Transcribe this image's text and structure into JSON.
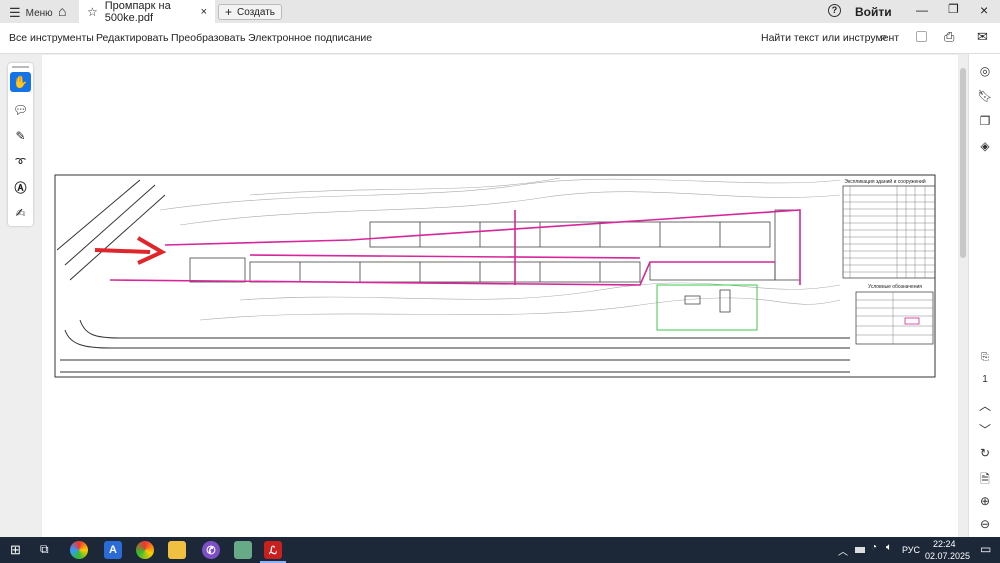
{
  "titlebar": {
    "menu_label": "Меню",
    "tab_title": "Промпарк на 500ke.pdf",
    "create_label": "Создать",
    "signin_label": "Войти"
  },
  "toolbar": {
    "items": [
      "Все инструменты",
      "Редактировать",
      "Преобразовать",
      "Электронное подписание"
    ],
    "search_label": "Найти текст или инструмент"
  },
  "document": {
    "table_title": "Экспликация зданий и сооружений",
    "legend_title": "Условные обозначения"
  },
  "right_sidebar": {
    "page_number": "1"
  },
  "taskbar": {
    "language": "РУС",
    "time": "22:24",
    "date": "02.07.2025"
  },
  "colors": {
    "route": "#d6269b",
    "arrow": "#e0262a",
    "green": "#3cc84a",
    "taskbar": "#1c2838"
  }
}
